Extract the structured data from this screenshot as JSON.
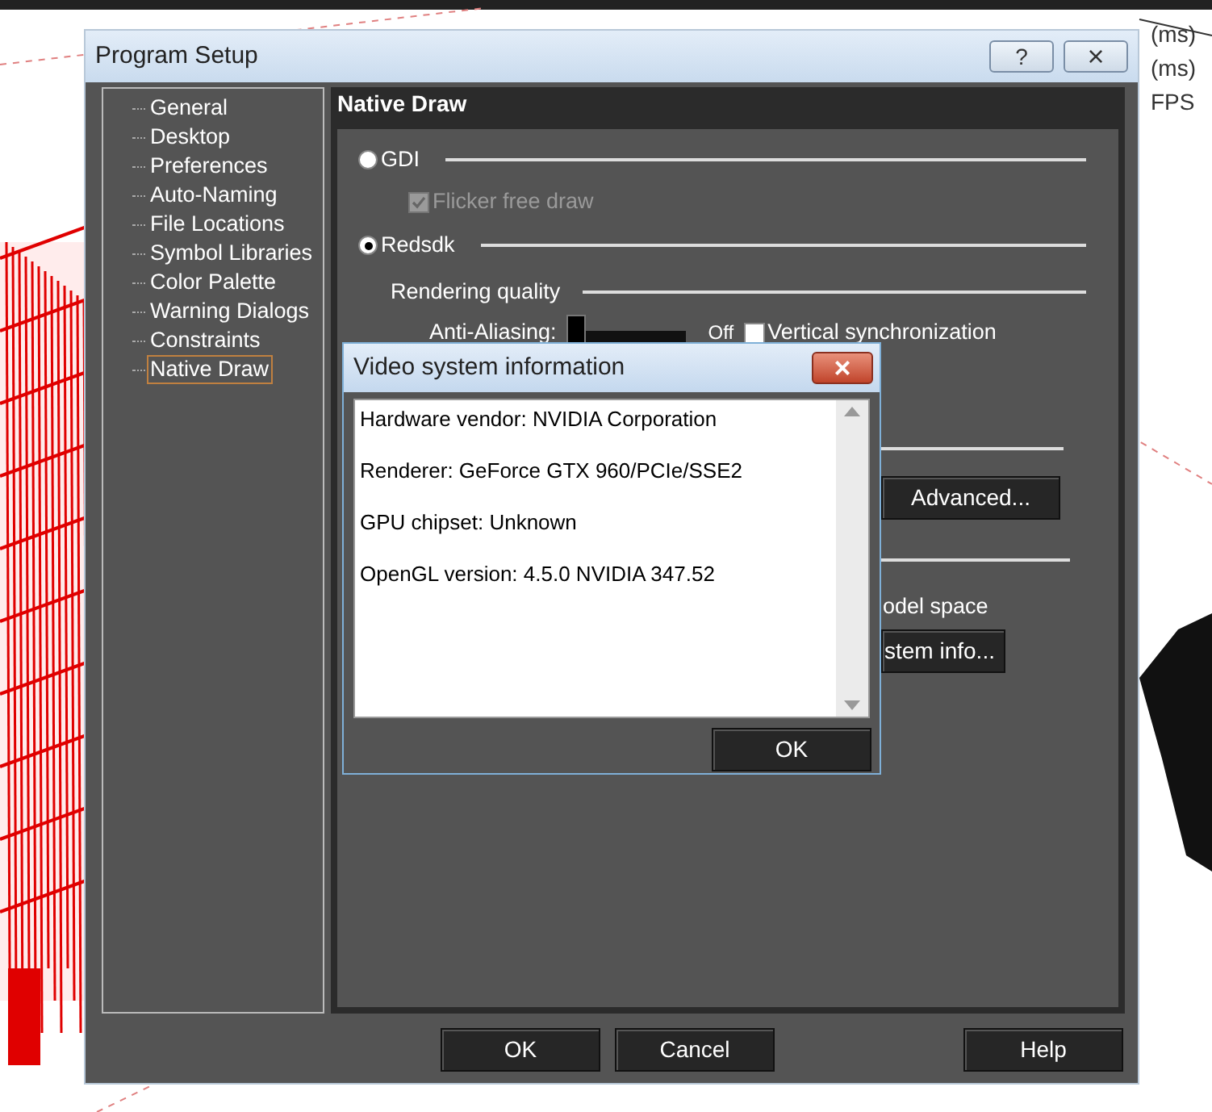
{
  "viewport_labels": [
    "(ms)",
    "(ms)",
    "FPS"
  ],
  "window": {
    "title": "Program Setup",
    "help_button": "?",
    "close_button": "×"
  },
  "sidebar": {
    "items": [
      {
        "label": "General",
        "selected": false
      },
      {
        "label": "Desktop",
        "selected": false
      },
      {
        "label": "Preferences",
        "selected": false
      },
      {
        "label": "Auto-Naming",
        "selected": false
      },
      {
        "label": "File Locations",
        "selected": false
      },
      {
        "label": "Symbol Libraries",
        "selected": false
      },
      {
        "label": "Color Palette",
        "selected": false
      },
      {
        "label": "Warning Dialogs",
        "selected": false
      },
      {
        "label": "Constraints",
        "selected": false
      },
      {
        "label": "Native Draw",
        "selected": true
      }
    ]
  },
  "panel": {
    "title": "Native Draw",
    "renderers": [
      {
        "label": "GDI",
        "selected": false
      },
      {
        "label": "Redsdk",
        "selected": true
      }
    ],
    "flicker_free": {
      "label": "Flicker free draw",
      "checked": true,
      "disabled": true
    },
    "rendering_quality": {
      "label": "Rendering quality",
      "anti_aliasing": {
        "label": "Anti-Aliasing:",
        "level": 0,
        "reading": "Off"
      },
      "vsync": {
        "label": "Vertical synchronization",
        "checked": false
      }
    },
    "advanced_button": "Advanced...",
    "model_space_label": "odel space",
    "system_info_button": "stem info..."
  },
  "buttons": [
    "OK",
    "Cancel",
    "Help"
  ],
  "video_dialog": {
    "title": "Video system information",
    "close_button": "×",
    "lines": [
      "Hardware vendor: NVIDIA Corporation",
      "Renderer: GeForce GTX 960/PCIe/SSE2",
      "GPU chipset: Unknown",
      "OpenGL version: 4.5.0 NVIDIA 347.52"
    ],
    "ok_button": "OK"
  }
}
